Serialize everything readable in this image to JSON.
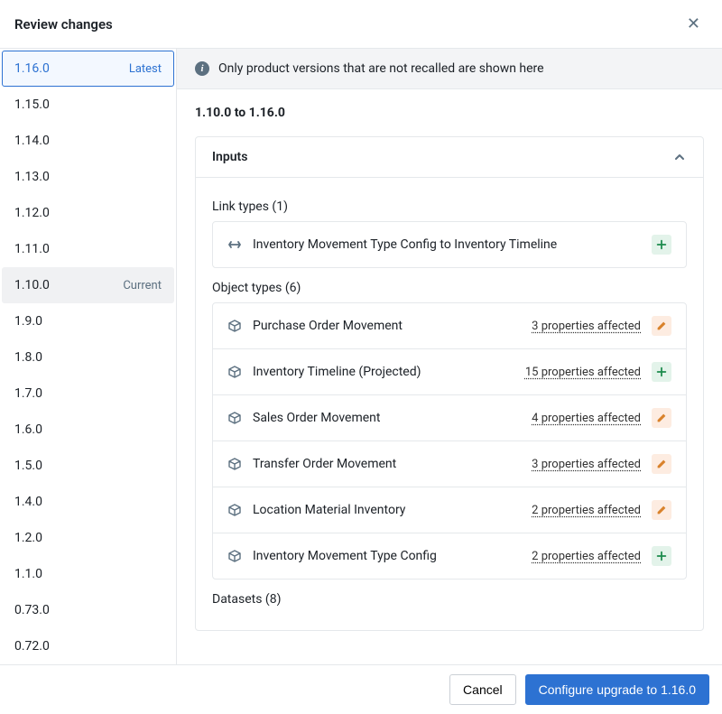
{
  "header": {
    "title": "Review changes"
  },
  "sidebar": {
    "versions": [
      {
        "v": "1.16.0",
        "tag": "Latest",
        "state": "selected"
      },
      {
        "v": "1.15.0",
        "tag": "",
        "state": ""
      },
      {
        "v": "1.14.0",
        "tag": "",
        "state": ""
      },
      {
        "v": "1.13.0",
        "tag": "",
        "state": ""
      },
      {
        "v": "1.12.0",
        "tag": "",
        "state": ""
      },
      {
        "v": "1.11.0",
        "tag": "",
        "state": ""
      },
      {
        "v": "1.10.0",
        "tag": "Current",
        "state": "current"
      },
      {
        "v": "1.9.0",
        "tag": "",
        "state": ""
      },
      {
        "v": "1.8.0",
        "tag": "",
        "state": ""
      },
      {
        "v": "1.7.0",
        "tag": "",
        "state": ""
      },
      {
        "v": "1.6.0",
        "tag": "",
        "state": ""
      },
      {
        "v": "1.5.0",
        "tag": "",
        "state": ""
      },
      {
        "v": "1.4.0",
        "tag": "",
        "state": ""
      },
      {
        "v": "1.2.0",
        "tag": "",
        "state": ""
      },
      {
        "v": "1.1.0",
        "tag": "",
        "state": ""
      },
      {
        "v": "0.73.0",
        "tag": "",
        "state": ""
      },
      {
        "v": "0.72.0",
        "tag": "",
        "state": ""
      }
    ]
  },
  "notice": "Only product versions that are not recalled are shown here",
  "range": "1.10.0 to 1.16.0",
  "section": {
    "title": "Inputs",
    "groups": [
      {
        "label": "Link types (1)",
        "items": [
          {
            "icon": "link",
            "name": "Inventory Movement Type Config to Inventory Timeline",
            "affected": "",
            "badge": "add"
          }
        ]
      },
      {
        "label": "Object types (6)",
        "items": [
          {
            "icon": "cube",
            "name": "Purchase Order Movement",
            "affected": "3 properties affected",
            "badge": "edit"
          },
          {
            "icon": "cube",
            "name": "Inventory Timeline (Projected)",
            "affected": "15 properties affected",
            "badge": "add"
          },
          {
            "icon": "cube",
            "name": "Sales Order Movement",
            "affected": "4 properties affected",
            "badge": "edit"
          },
          {
            "icon": "cube",
            "name": "Transfer Order Movement",
            "affected": "3 properties affected",
            "badge": "edit"
          },
          {
            "icon": "cube",
            "name": "Location Material Inventory",
            "affected": "2 properties affected",
            "badge": "edit"
          },
          {
            "icon": "cube",
            "name": "Inventory Movement Type Config",
            "affected": "2 properties affected",
            "badge": "add"
          }
        ]
      },
      {
        "label": "Datasets (8)",
        "items": []
      }
    ]
  },
  "footer": {
    "cancel": "Cancel",
    "configure": "Configure upgrade to 1.16.0"
  }
}
